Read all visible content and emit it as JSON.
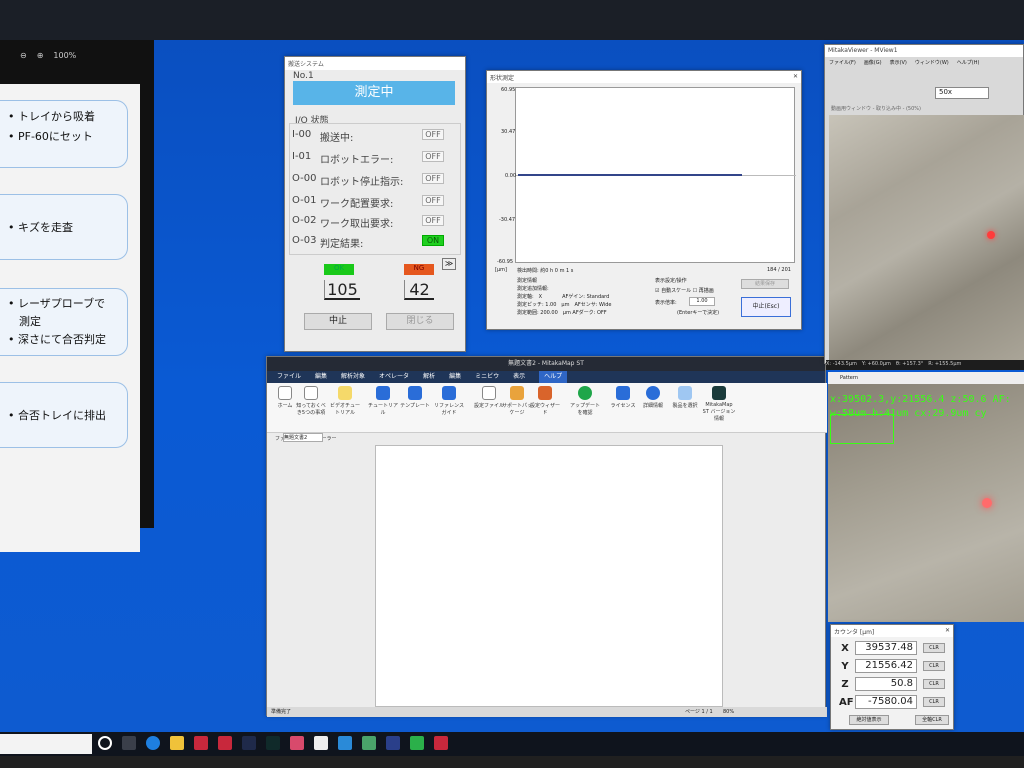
{
  "slide": {
    "zoom": "100%",
    "items": [
      {
        "lines": [
          "• トレイから吸着",
          "• PF-60にセット"
        ]
      },
      {
        "lines": [
          "• キズを走査"
        ]
      },
      {
        "lines": [
          "• レーザプローブで",
          "　測定",
          "• 深さにて合否判定"
        ]
      },
      {
        "lines": [
          "• 合否トレイに排出"
        ]
      }
    ]
  },
  "xfer": {
    "title": "搬送システム",
    "no": "No.1",
    "state": "測定中",
    "io_header": "I/O 状態",
    "rows": [
      {
        "code": "I-00",
        "label": "搬送中:",
        "val": "OFF"
      },
      {
        "code": "I-01",
        "label": "ロボットエラー:",
        "val": "OFF"
      },
      {
        "code": "O-00",
        "label": "ロボット停止指示:",
        "val": "OFF"
      },
      {
        "code": "O-01",
        "label": "ワーク配置要求:",
        "val": "OFF"
      },
      {
        "code": "O-02",
        "label": "ワーク取出要求:",
        "val": "OFF"
      },
      {
        "code": "O-03",
        "label": "判定結果:",
        "val": "ON"
      }
    ],
    "ok_label": "OK",
    "ng_label": "NG",
    "ok_count": "105",
    "ng_count": "42",
    "stop": "中止",
    "close": "閉じる",
    "more": "≫"
  },
  "shape": {
    "title": "形状測定",
    "y_ticks": [
      "60.95",
      "30.47",
      "0.00",
      "-30.47",
      "-60.95"
    ],
    "unit": "[μm]",
    "elapsed": "検出時間: 約0 h 0 m 1 s",
    "count": "184 / 201",
    "info_header": "測定情報",
    "info": [
      "測定追加情報:",
      "測定軸:　X　　　　AFゲイン: Standard",
      "測定ピッチ: 1.00　μm　AFセンサ: Wide",
      "測定範囲: 200.00　μm AFダーク: OFF"
    ],
    "disp_header": "表示設定/操作",
    "auto": "自動スケール",
    "redraw": "再描画",
    "ratio": "表示倍率:",
    "ratio_val": "1.00",
    "enter": "(Enterキーで決定)",
    "result": "結果保存",
    "stop": "中止(Esc)"
  },
  "office": {
    "title": "無題文書2 - MitakaMap ST",
    "menu": [
      "ファイル",
      "編集",
      "解析対象",
      "オペレータ",
      "解析",
      "編集",
      "ミニビウ",
      "表示",
      "ヘルプ"
    ],
    "ribbon": [
      "ホーム",
      "知っておくべき5つの事項",
      "ビデオチュートリアル",
      "チュートリアル",
      "テンプレート",
      "リファレンスガイド",
      "設定ファイル",
      "サポートパッケージ",
      "設定ウィザード",
      "アップデートを確認",
      "ライセンス",
      "詳細情報",
      "製品を選択",
      "MitakaMap ST バージョン情報"
    ],
    "groups": [
      "ヘルプ",
      "サポート",
      "アップデート",
      "設定",
      "バージョン情報"
    ],
    "tab": "無題文書2",
    "side": "ファイル エクスプローラー",
    "status": "準備完了",
    "page": "ページ 1 / 1",
    "zoom": "80%"
  },
  "cam": {
    "title": "MitakaViewer - MView1",
    "menu": [
      "ファイル(F)",
      "画像(G)",
      "表示(V)",
      "ウィンドウ(W)",
      "ヘルプ(H)"
    ],
    "mag": "50x",
    "pane": "動画用ウィンドウ - 取り込み中 - (50%)",
    "coords": "X: -143.5μm　Y: +60.0μm　θ: +157.3°　R: +155.5μm"
  },
  "pattern": {
    "title": "Pattern",
    "overlay1": "x:39502.3,y:21556.4 z:50.6 AF:",
    "overlay2": "w:58um h:41um cx:29.9um cy"
  },
  "counter": {
    "title": "カウンタ [μm]",
    "rows": [
      {
        "k": "X",
        "v": "39537.48"
      },
      {
        "k": "Y",
        "v": "21556.42"
      },
      {
        "k": "Z",
        "v": "50.8"
      },
      {
        "k": "AF",
        "v": "-7580.04"
      }
    ],
    "clr": "CLR",
    "view": "絶対値表示",
    "allclr": "全軸CLR"
  },
  "colors": {
    "accent": "#58b4e8",
    "ok": "#19c919",
    "ng": "#e5571e",
    "on": "#1fcf1f"
  }
}
